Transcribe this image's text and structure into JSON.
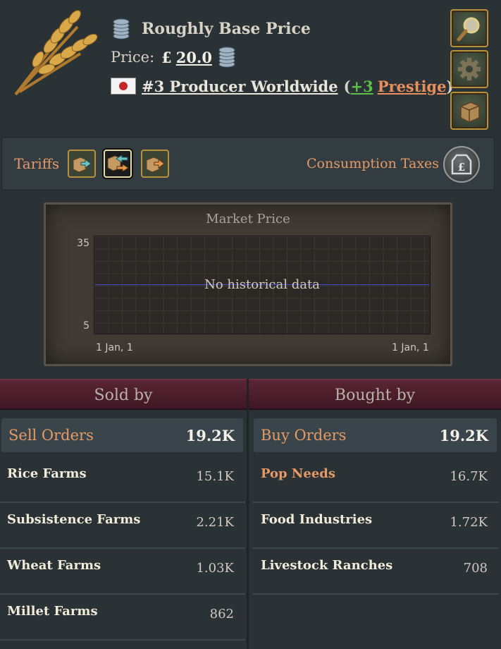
{
  "header": {
    "price_category": "Roughly Base Price",
    "price_label": "Price:",
    "currency_symbol": "£",
    "price_value": "20.0",
    "rank": "#3 Producer Worldwide",
    "open_paren": "(",
    "prestige_bonus": "+3",
    "prestige_label": "Prestige",
    "close_paren": ")"
  },
  "side_buttons": [
    {
      "icon": "magnifier-icon"
    },
    {
      "icon": "gear-icon"
    },
    {
      "icon": "crate-icon"
    }
  ],
  "tariffs": {
    "label": "Tariffs",
    "buttons": [
      {
        "icon": "import-arrow-icon"
      },
      {
        "icon": "two-way-arrow-icon",
        "active": true
      },
      {
        "icon": "export-arrow-icon"
      }
    ],
    "consumption_label": "Consumption Taxes",
    "consumption_icon": "money-tag-icon"
  },
  "chart": {
    "title": "Market Price",
    "empty_message": "No historical data",
    "y_tick_top": "35",
    "y_tick_bottom": "5",
    "x_tick_left": "1 Jan, 1",
    "x_tick_right": "1 Jan, 1"
  },
  "sold_by": {
    "title": "Sold by",
    "orders_label": "Sell Orders",
    "orders_total": "19.2K",
    "rows": [
      {
        "name": "Rice Farms",
        "value": "15.1K"
      },
      {
        "name": "Subsistence Farms",
        "value": "2.21K"
      },
      {
        "name": "Wheat Farms",
        "value": "1.03K"
      },
      {
        "name": "Millet Farms",
        "value": "862"
      }
    ]
  },
  "bought_by": {
    "title": "Bought by",
    "orders_label": "Buy Orders",
    "orders_total": "19.2K",
    "rows": [
      {
        "name": "Pop Needs",
        "value": "16.7K"
      },
      {
        "name": "Food Industries",
        "value": "1.72K"
      },
      {
        "name": "Livestock Ranches",
        "value": "708"
      }
    ]
  },
  "colors": {
    "accent_orange": "#e59a66",
    "prestige_green": "#5fbf4b",
    "banner_red": "#5a2535",
    "gold_border": "#b5913e"
  }
}
